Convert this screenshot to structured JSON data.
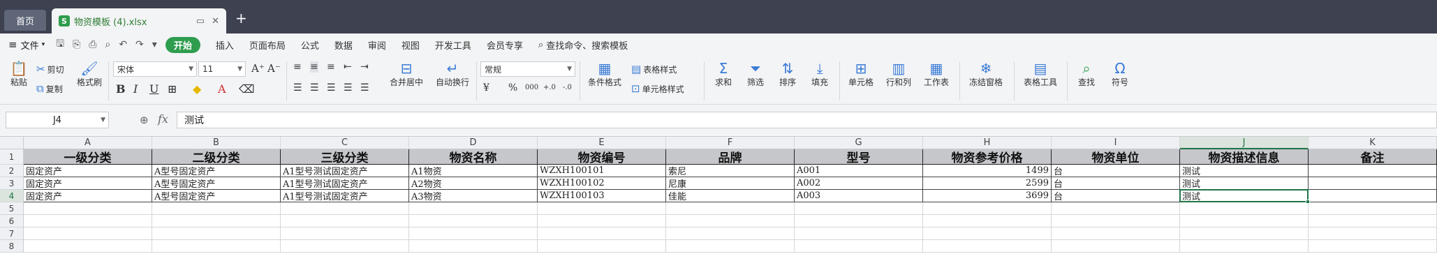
{
  "tabs": {
    "home": "首页",
    "file": "物资模板 (4).xlsx",
    "file_icon": "S"
  },
  "menu": {
    "file": "文件",
    "start": "开始",
    "items": [
      "插入",
      "页面布局",
      "公式",
      "数据",
      "审阅",
      "视图",
      "开发工具",
      "会员专享"
    ],
    "search": "查找命令、搜索模板"
  },
  "ribbon": {
    "paste": "粘贴",
    "cut": "剪切",
    "copy": "复制",
    "format_painter": "格式刷",
    "font_name": "宋体",
    "font_size": "11",
    "merge_center": "合并居中",
    "wrap_text": "自动换行",
    "number_format": "常规",
    "cond_format": "条件格式",
    "table_style": "表格样式",
    "cell_style": "单元格样式",
    "sum": "求和",
    "filter": "筛选",
    "sort": "排序",
    "fill": "填充",
    "cell": "单元格",
    "row_col": "行和列",
    "worksheet": "工作表",
    "freeze": "冻结窗格",
    "table_tools": "表格工具",
    "find": "查找",
    "symbol": "符号",
    "currency": "¥",
    "percent": "%",
    "thousands": "000",
    "inc_dec": "+.0",
    "dec_dec": "-.0"
  },
  "formula_bar": {
    "name_box": "J4",
    "fx": "fx",
    "value": "测试"
  },
  "sheet": {
    "columns": [
      "A",
      "B",
      "C",
      "D",
      "E",
      "F",
      "G",
      "H",
      "I",
      "J",
      "K"
    ],
    "rows": [
      "1",
      "2",
      "3",
      "4",
      "5",
      "6",
      "7",
      "8"
    ],
    "header": [
      "一级分类",
      "二级分类",
      "三级分类",
      "物资名称",
      "物资编号",
      "品牌",
      "型号",
      "物资参考价格",
      "物资单位",
      "物资描述信息",
      "备注"
    ],
    "data": [
      [
        "固定资产",
        "A型号固定资产",
        "A1型号测试固定资产",
        "A1物资",
        "WZXH100101",
        "索尼",
        "A001",
        "1499",
        "台",
        "测试",
        ""
      ],
      [
        "固定资产",
        "A型号固定资产",
        "A1型号测试固定资产",
        "A2物资",
        "WZXH100102",
        "尼康",
        "A002",
        "2599",
        "台",
        "测试",
        ""
      ],
      [
        "固定资产",
        "A型号固定资产",
        "A1型号测试固定资产",
        "A3物资",
        "WZXH100103",
        "佳能",
        "A003",
        "3699",
        "台",
        "测试",
        ""
      ]
    ],
    "active_cell": "J4"
  },
  "colors": {
    "accent": "#2e9d4e",
    "tabbar": "#3d4150",
    "selection": "#217346"
  }
}
